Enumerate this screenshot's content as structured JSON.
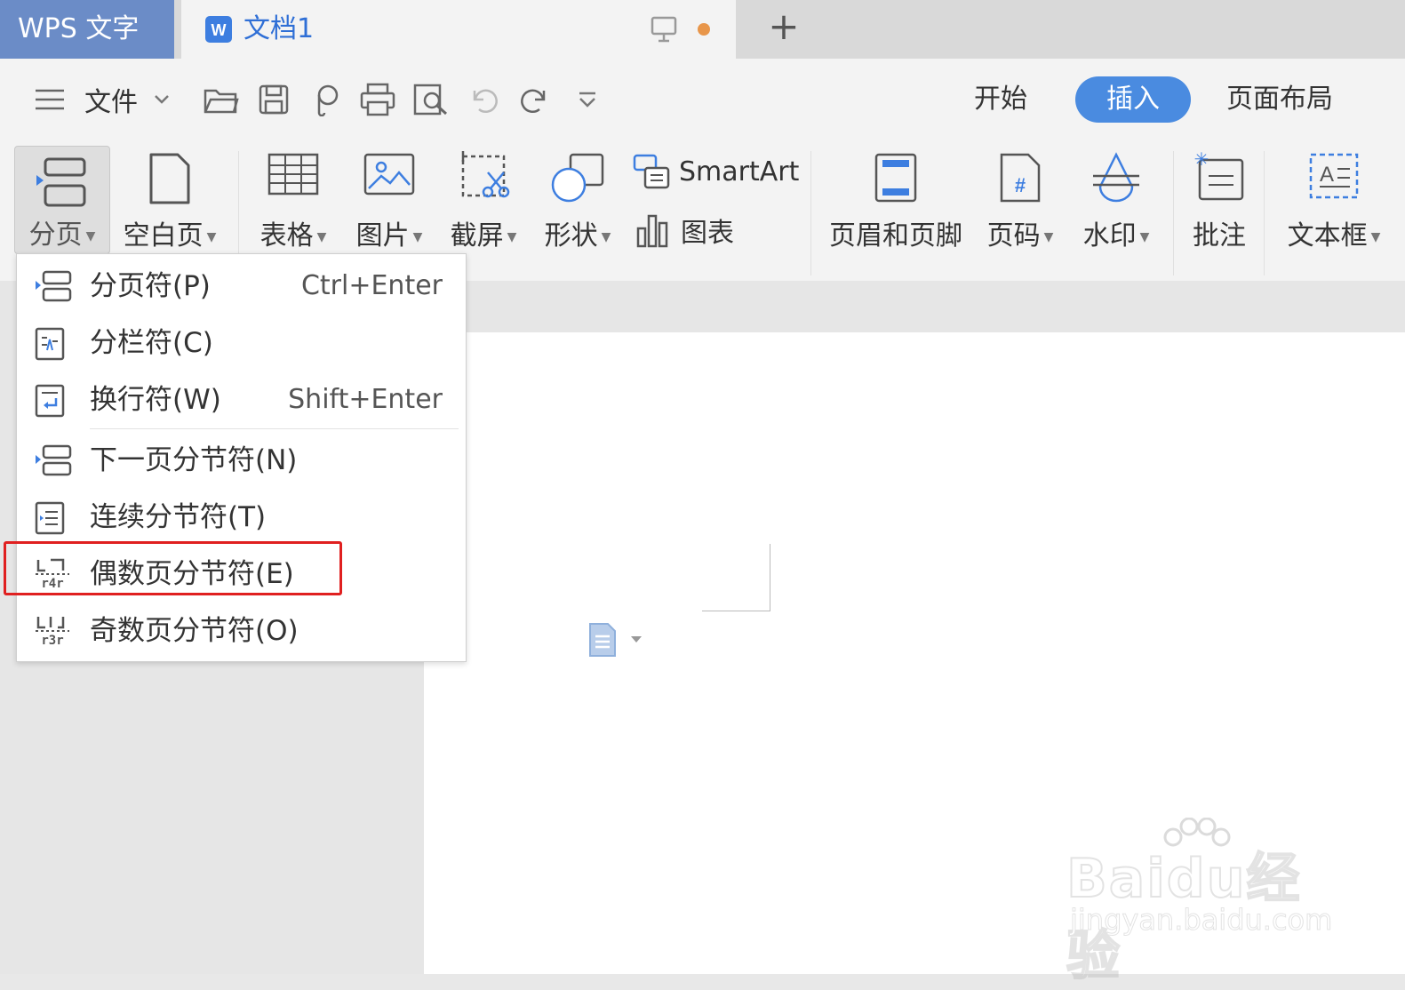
{
  "titlebar": {
    "app_name": "WPS 文字",
    "doc_tab_title": "文档1",
    "new_tab": "+"
  },
  "quickbar": {
    "file_menu": "文件",
    "tabs": [
      "开始",
      "插入",
      "页面布局"
    ],
    "active_tab": "插入"
  },
  "ribbon": {
    "page_break": "分页",
    "blank_page": "空白页",
    "table": "表格",
    "picture": "图片",
    "screenshot": "截屏",
    "shapes": "形状",
    "smartart": "SmartArt",
    "chart": "图表",
    "header_footer": "页眉和页脚",
    "page_number": "页码",
    "watermark": "水印",
    "comment": "批注",
    "textbox": "文本框"
  },
  "dropdown": {
    "items": [
      {
        "label": "分页符(P)",
        "shortcut": "Ctrl+Enter"
      },
      {
        "label": "分栏符(C)",
        "shortcut": ""
      },
      {
        "label": "换行符(W)",
        "shortcut": "Shift+Enter"
      },
      {
        "label": "下一页分节符(N)",
        "shortcut": ""
      },
      {
        "label": "连续分节符(T)",
        "shortcut": ""
      },
      {
        "label": "偶数页分节符(E)",
        "shortcut": ""
      },
      {
        "label": "奇数页分节符(O)",
        "shortcut": ""
      }
    ],
    "highlighted": "偶数页分节符(E)"
  },
  "watermark_overlay": {
    "logo_text": "Baidu经验",
    "url": "jingyan.baidu.com"
  },
  "colors": {
    "accent": "#4a8be0",
    "app_tab": "#6b8cc7",
    "highlight_box": "#e02020"
  }
}
